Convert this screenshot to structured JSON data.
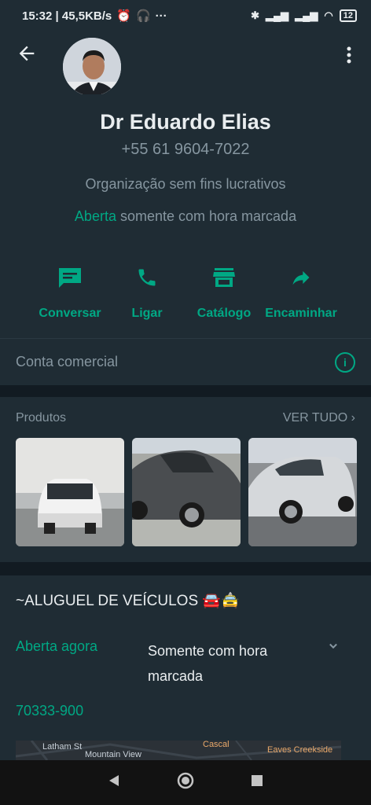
{
  "status_bar": {
    "left_text": "15:32 | 45,5KB/s",
    "battery": "12",
    "icons": [
      "alarm-icon",
      "headset-icon",
      "more-dots-icon",
      "bluetooth-icon",
      "signal-icon",
      "signal-icon",
      "wifi-icon",
      "battery-icon"
    ]
  },
  "header": {
    "back_icon": "arrow-back-icon",
    "menu_icon": "more-vert-icon"
  },
  "profile": {
    "name": "Dr Eduardo Elias",
    "phone": "+55 61 9604-7022",
    "category": "Organização sem fins lucrativos",
    "hours_open": "Aberta",
    "hours_rest": " somente com hora marcada"
  },
  "actions": [
    {
      "label": "Conversar",
      "icon": "chat-icon"
    },
    {
      "label": "Ligar",
      "icon": "phone-icon"
    },
    {
      "label": "Catálogo",
      "icon": "store-icon"
    },
    {
      "label": "Encaminhar",
      "icon": "forward-icon"
    }
  ],
  "account": {
    "label": "Conta comercial"
  },
  "products": {
    "title": "Produtos",
    "see_all": "VER TUDO"
  },
  "about": {
    "title": "~ALUGUEL DE VEÍCULOS 🚘🚖",
    "open_now": "Aberta agora",
    "schedule": "Somente com hora marcada",
    "cep": "70333-900"
  },
  "map": {
    "labels": [
      "Latham St",
      "Cascal",
      "Mountain View",
      "Eaves Creekside"
    ]
  },
  "colors": {
    "accent": "#00a884",
    "background": "#121b22",
    "surface": "#1f2c34"
  }
}
